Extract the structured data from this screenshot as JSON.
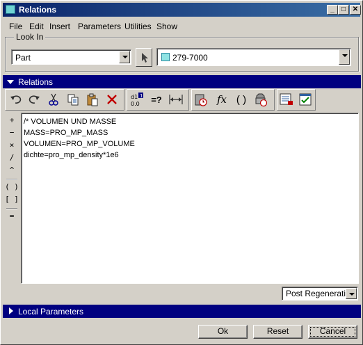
{
  "window": {
    "title": "Relations",
    "controls": [
      "_",
      "□",
      "✕"
    ]
  },
  "menu": [
    "File",
    "Edit",
    "Insert",
    "Parameters",
    "Utilities",
    "Show"
  ],
  "lookin": {
    "legend": "Look In",
    "type_value": "Part",
    "model_value": "279-7000"
  },
  "relations_section": {
    "label": "Relations"
  },
  "toolbar": {
    "icons": [
      "undo-icon",
      "redo-icon",
      "cut-icon",
      "copy-icon",
      "paste-icon",
      "delete-icon",
      "evaluate-display-icon",
      "verify-icon",
      "measure-distance-icon",
      "sort-icon",
      "function-icon",
      "parentheses-icon",
      "execute-icon",
      "show-dimensions-icon",
      "verify-relations-icon"
    ],
    "verify_label": "=?",
    "function_label": "fx",
    "paren_label": "( )"
  },
  "side_operators": [
    "+",
    "−",
    "×",
    "/",
    "^",
    "( )",
    "[ ]",
    "="
  ],
  "editor": {
    "lines": [
      "/* VOLUMEN UND MASSE",
      "MASS=PRO_MP_MASS",
      "VOLUMEN=PRO_MP_VOLUME",
      "dichte=pro_mp_density*1e6"
    ]
  },
  "regeneration_select": {
    "value": "Post Regeneration"
  },
  "local_parameters_section": {
    "label": "Local Parameters"
  },
  "buttons": {
    "ok": "Ok",
    "reset": "Reset",
    "cancel": "Cancel"
  },
  "colors": {
    "title_gradient_start": "#0a246a",
    "section_bar": "#000080",
    "face": "#d4d0c8"
  }
}
